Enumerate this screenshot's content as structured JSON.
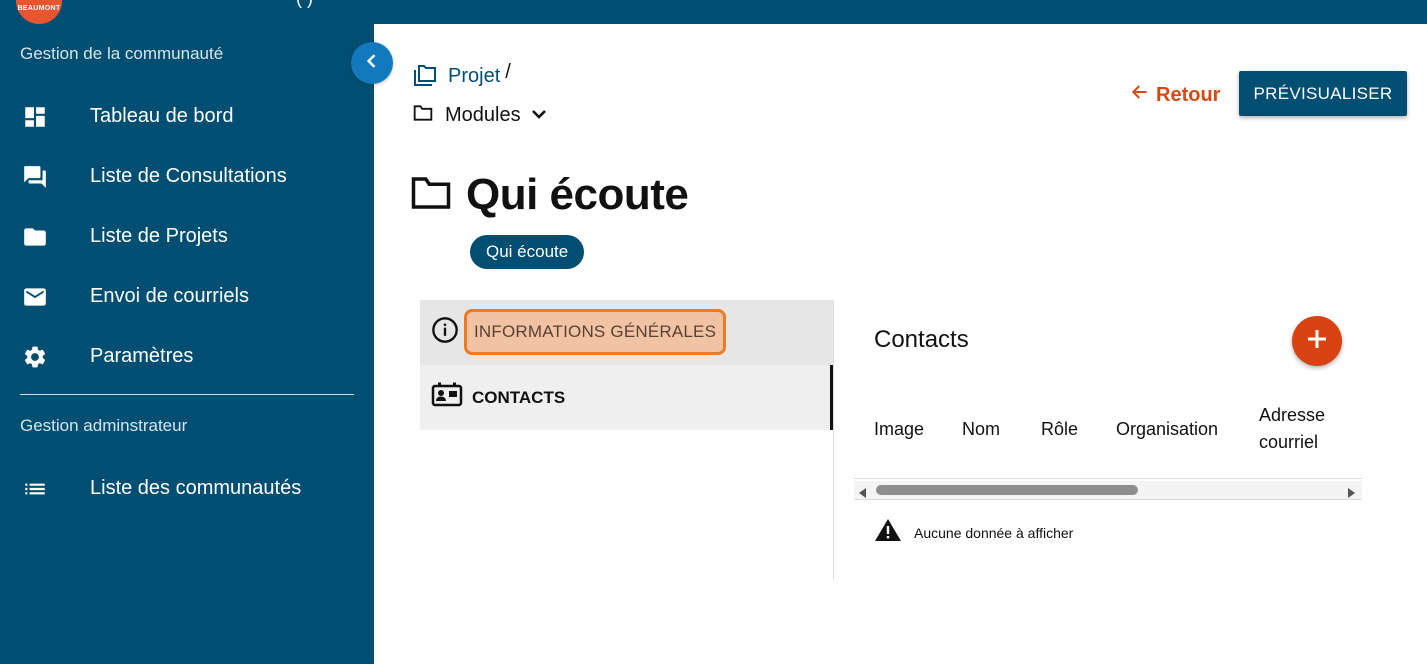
{
  "topbar": {
    "logo_text": "BEAUMONT",
    "title_fragment": "(   )"
  },
  "sidebar": {
    "section1_label": "Gestion de la communauté",
    "items": [
      {
        "label": "Tableau de bord",
        "icon": "dashboard-icon"
      },
      {
        "label": "Liste de Consultations",
        "icon": "forum-icon"
      },
      {
        "label": "Liste de Projets",
        "icon": "folder-icon"
      },
      {
        "label": "Envoi de courriels",
        "icon": "mail-icon"
      },
      {
        "label": "Paramètres",
        "icon": "gear-icon"
      }
    ],
    "section2_label": "Gestion adminstrateur",
    "admin_items": [
      {
        "label": "Liste des communautés",
        "icon": "list-icon"
      }
    ]
  },
  "breadcrumb": {
    "project": "Projet",
    "separator": "/",
    "modules": "Modules"
  },
  "actions": {
    "back": "Retour",
    "preview": "PRÉVISUALISER"
  },
  "page": {
    "title": "Qui écoute",
    "chip": "Qui écoute"
  },
  "tabs": {
    "info": "INFORMATIONS GÉNÉRALES",
    "contacts": "CONTACTS"
  },
  "contacts": {
    "title": "Contacts",
    "columns": [
      "Image",
      "Nom",
      "Rôle",
      "Organisation",
      "Adresse",
      "courriel"
    ],
    "empty_message": "Aucune donnée à afficher"
  },
  "colors": {
    "primary": "#004f73",
    "accent": "#d54b13",
    "highlight": "#ee7a22"
  }
}
